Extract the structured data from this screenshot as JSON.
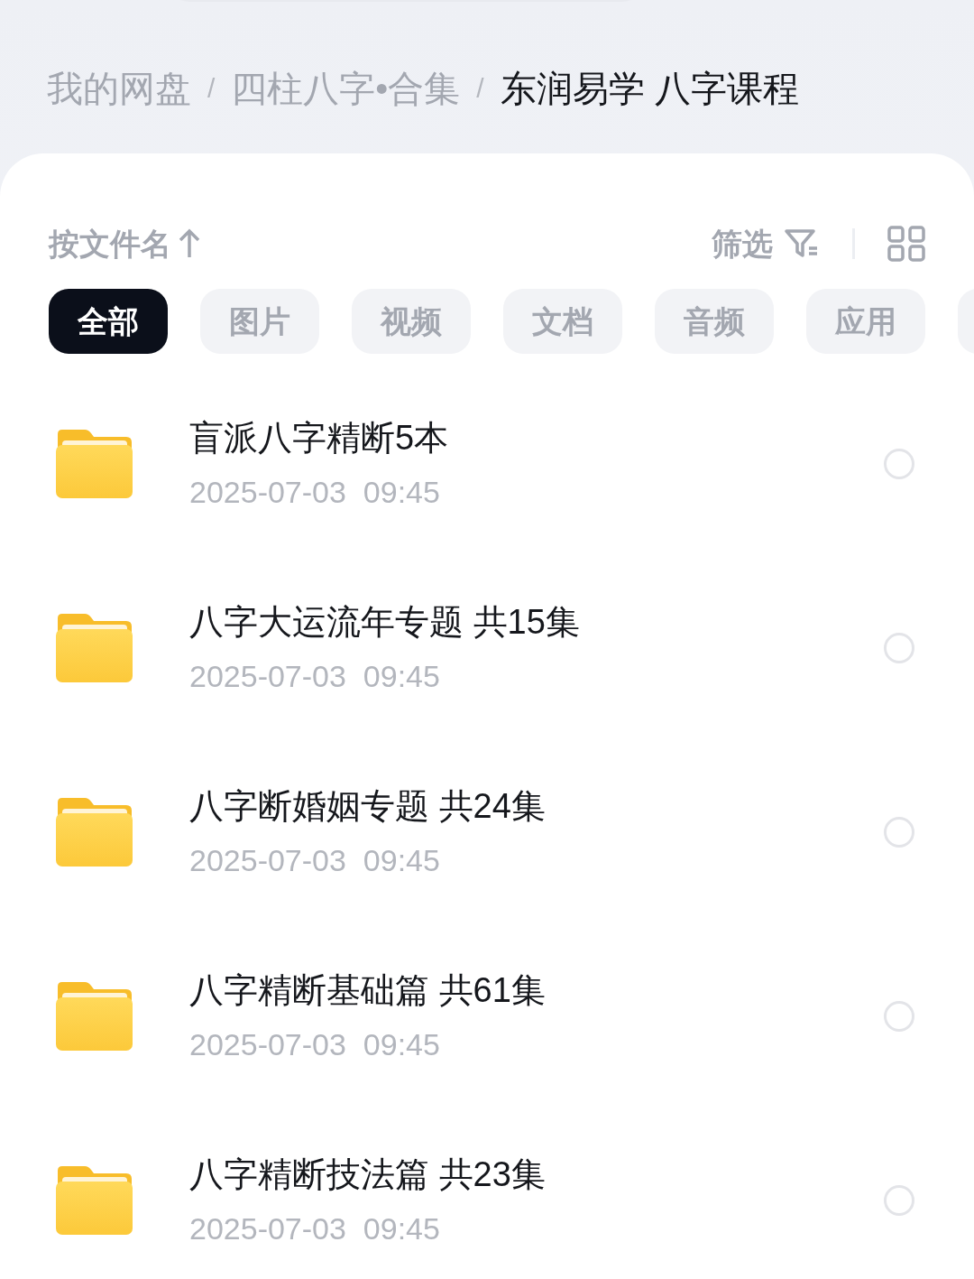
{
  "breadcrumb": [
    {
      "label": "我的网盘",
      "selected": false
    },
    {
      "label": "四柱八字•合集",
      "selected": false
    },
    {
      "label": "东润易学 八字课程",
      "selected": true
    }
  ],
  "breadcrumb_separator": "/",
  "sort": {
    "label": "按文件名"
  },
  "filter": {
    "label": "筛选"
  },
  "tabs": [
    {
      "label": "全部",
      "selected": true
    },
    {
      "label": "图片",
      "selected": false
    },
    {
      "label": "视频",
      "selected": false
    },
    {
      "label": "文档",
      "selected": false
    },
    {
      "label": "音频",
      "selected": false
    },
    {
      "label": "应用",
      "selected": false
    },
    {
      "selected": false
    }
  ],
  "files": [
    {
      "name": "盲派八字精断5本",
      "time": "2025-07-03  09:45",
      "checked": false
    },
    {
      "name": "八字大运流年专题 共15集",
      "time": "2025-07-03  09:45",
      "checked": false
    },
    {
      "name": "八字断婚姻专题 共24集",
      "time": "2025-07-03  09:45",
      "checked": false
    },
    {
      "name": "八字精断基础篇 共61集",
      "time": "2025-07-03  09:45",
      "checked": false
    },
    {
      "name": "八字精断技法篇 共23集",
      "time": "2025-07-03  09:45",
      "checked": false
    }
  ]
}
